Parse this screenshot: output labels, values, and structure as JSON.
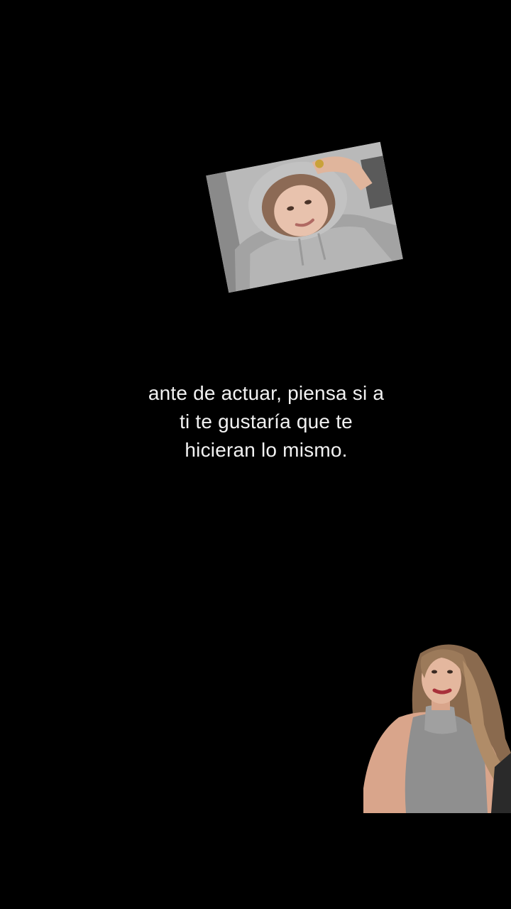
{
  "caption": {
    "text": "ante de actuar, piensa si a\nti te gustaría que te\nhicieran lo mismo."
  },
  "colors": {
    "background": "#000000",
    "caption_text": "#f2f2f2"
  },
  "images": [
    {
      "name": "girl-in-gray-hoodie-photo"
    },
    {
      "name": "woman-in-gray-top-cutout"
    }
  ]
}
